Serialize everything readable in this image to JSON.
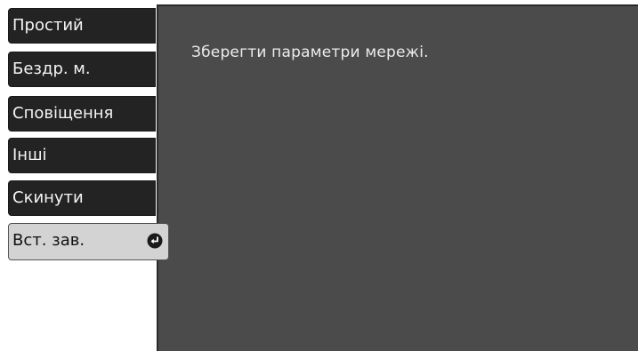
{
  "menu": {
    "items": [
      {
        "label": "Простий"
      },
      {
        "label": "Бездр. м."
      },
      {
        "label": "Сповіщення"
      },
      {
        "label": "Інші"
      },
      {
        "label": "Скинути"
      },
      {
        "label": "Вст. зав.",
        "selected": true,
        "icon": "enter-icon"
      }
    ]
  },
  "content": {
    "help_text": "Зберегти параметри мережі."
  },
  "colors": {
    "panel": "#4b4b4b",
    "menu_item": "#232323",
    "menu_item_selected": "#d3d3d3"
  }
}
